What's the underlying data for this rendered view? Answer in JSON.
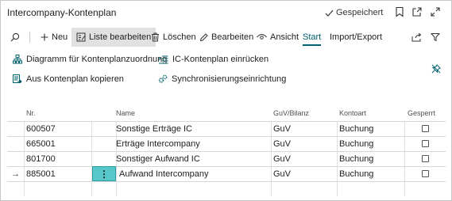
{
  "window": {
    "title": "Intercompany-Kontenplan",
    "saved_label": "Gespeichert"
  },
  "actionbar": {
    "new_label": "Neu",
    "edit_list_label": "Liste bearbeiten",
    "delete_label": "Löschen",
    "edit_label": "Bearbeiten",
    "view_label": "Ansicht",
    "start_label": "Start",
    "import_export_label": "Import/Export"
  },
  "promoted": {
    "diagram_label": "Diagramm für Kontenplanzuordnung",
    "copy_label": "Aus Kontenplan kopieren",
    "indent_label": "IC-Kontenplan einrücken",
    "sync_label": "Synchronisierungseinrichtung"
  },
  "table": {
    "headers": {
      "nr": "Nr.",
      "name": "Name",
      "guv": "GuV/Bilanz",
      "kontoart": "Kontoart",
      "gesperrt": "Gesperrt"
    },
    "rows": [
      {
        "nr": "600507",
        "name": "Sonstige Erträge IC",
        "guv": "GuV",
        "kontoart": "Buchung",
        "gesperrt": false
      },
      {
        "nr": "665001",
        "name": "Erträge Intercompany",
        "guv": "GuV",
        "kontoart": "Buchung",
        "gesperrt": false
      },
      {
        "nr": "801700",
        "name": "Sonstiger Aufwand IC",
        "guv": "GuV",
        "kontoart": "Buchung",
        "gesperrt": false
      },
      {
        "nr": "885001",
        "name": "Aufwand Intercompany",
        "guv": "GuV",
        "kontoart": "Buchung",
        "gesperrt": false
      }
    ],
    "current_row_marker": "→",
    "row_menu_glyph": "⋮"
  },
  "colors": {
    "accent": "#00626e",
    "selected_cell": "#57c7c9",
    "selected_button_bg": "#e1e1e1"
  }
}
